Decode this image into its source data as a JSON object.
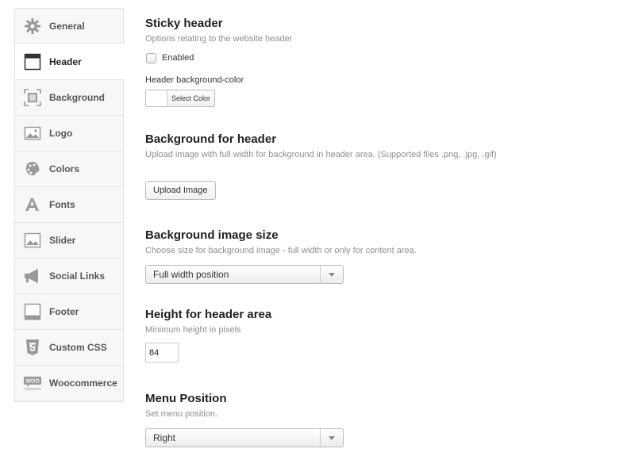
{
  "sidebar": {
    "items": [
      {
        "label": "General",
        "icon": "gear-icon"
      },
      {
        "label": "Header",
        "icon": "header-layout-icon",
        "active": true
      },
      {
        "label": "Background",
        "icon": "background-frame-icon"
      },
      {
        "label": "Logo",
        "icon": "image-icon"
      },
      {
        "label": "Colors",
        "icon": "palette-icon"
      },
      {
        "label": "Fonts",
        "icon": "font-icon"
      },
      {
        "label": "Slider",
        "icon": "slider-image-icon"
      },
      {
        "label": "Social Links",
        "icon": "megaphone-icon"
      },
      {
        "label": "Footer",
        "icon": "footer-layout-icon"
      },
      {
        "label": "Custom CSS",
        "icon": "css3-icon"
      },
      {
        "label": "Woocommerce",
        "icon": "woocommerce-icon"
      }
    ]
  },
  "sticky_header": {
    "title": "Sticky header",
    "description": "Options relating to the website header",
    "enabled_label": "Enabled",
    "enabled": false,
    "bg_color_label": "Header background-color",
    "select_color_label": "Select Color"
  },
  "bg_header": {
    "title": "Background for header",
    "description": "Upload image with full width for background in header area. (Supported files .png, .jpg, .gif)",
    "upload_label": "Upload Image"
  },
  "bg_size": {
    "title": "Background image size",
    "description": "Choose size for background image - full width or only for content area.",
    "selected": "Full width position"
  },
  "height": {
    "title": "Height for header area",
    "description": "Minimum height in pixels",
    "value": "84"
  },
  "menu_position": {
    "title": "Menu Position",
    "description": "Set menu position.",
    "selected": "Right"
  }
}
